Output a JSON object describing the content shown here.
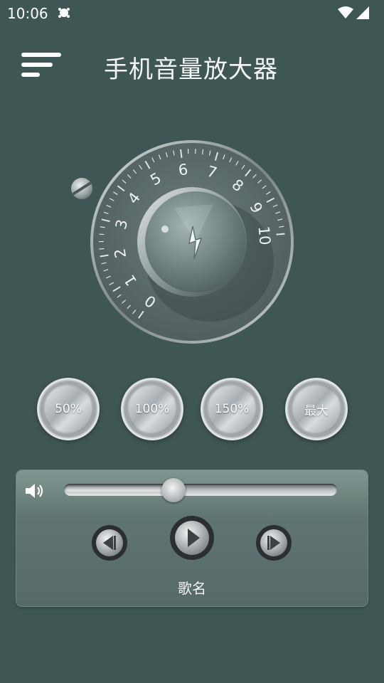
{
  "status_bar": {
    "time": "10:06"
  },
  "header": {
    "title": "手机音量放大器"
  },
  "knob": {
    "scale_labels": [
      "0",
      "1",
      "2",
      "3",
      "4",
      "5",
      "6",
      "7",
      "8",
      "9",
      "10"
    ],
    "level": 5.3
  },
  "presets": [
    {
      "label": "50%"
    },
    {
      "label": "100%"
    },
    {
      "label": "150%"
    },
    {
      "label": "最大"
    }
  ],
  "player": {
    "song_name": "歌名",
    "progress": 0.4
  },
  "colors": {
    "background": "#3f5754",
    "panel": "#5f7572",
    "knob_face": "#5b6b6a"
  }
}
